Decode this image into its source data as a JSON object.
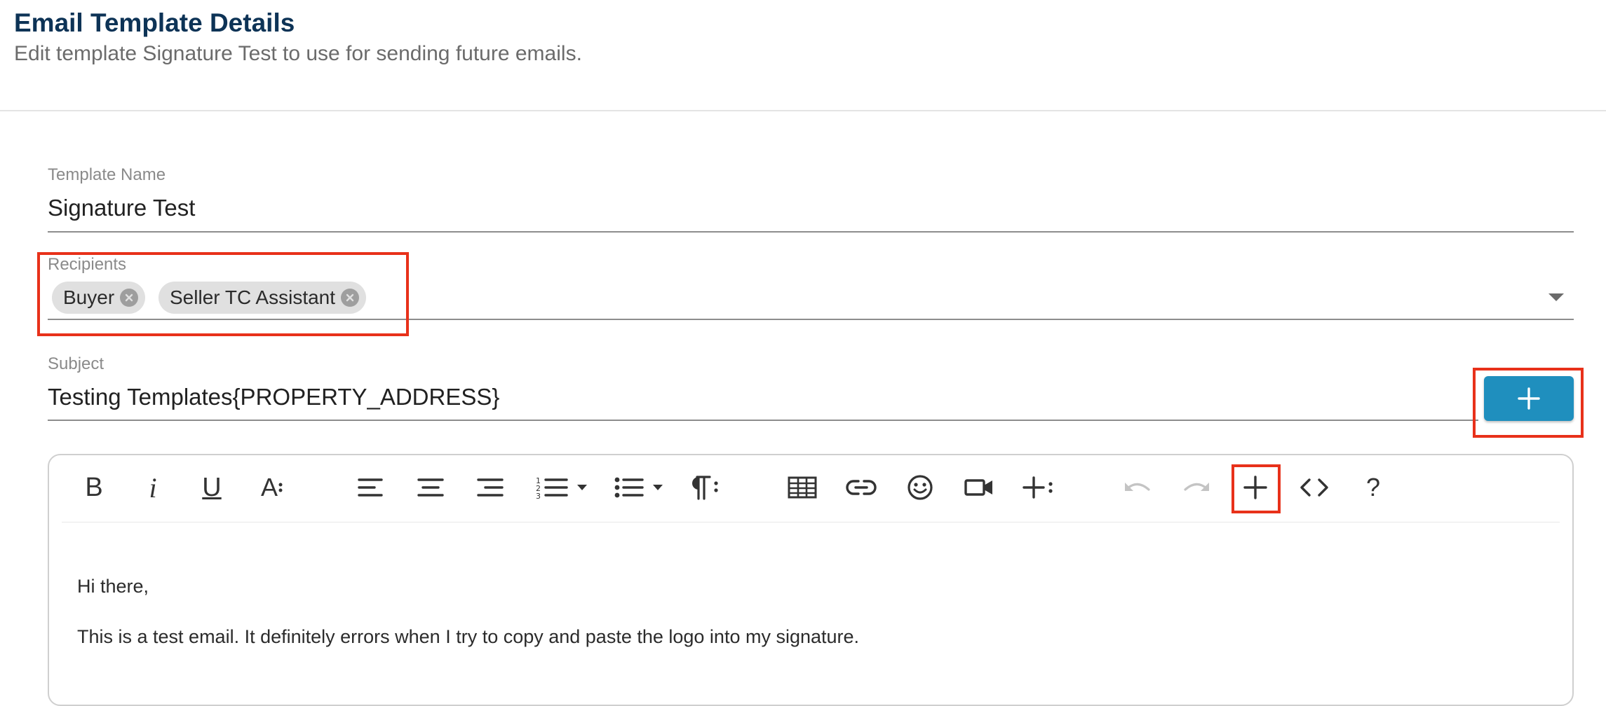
{
  "header": {
    "title": "Email Template Details",
    "subtitle": "Edit template Signature Test to use for sending future emails."
  },
  "form": {
    "template_name": {
      "label": "Template Name",
      "value": "Signature Test"
    },
    "recipients": {
      "label": "Recipients",
      "chips": [
        "Buyer",
        "Seller TC Assistant"
      ]
    },
    "subject": {
      "label": "Subject",
      "value": "Testing Templates{PROPERTY_ADDRESS}"
    }
  },
  "editor": {
    "toolbar": {
      "bold": "B",
      "italic": "i",
      "underline": "U",
      "font_size": "A",
      "help": "?"
    },
    "icons": [
      "bold-icon",
      "italic-icon",
      "underline-icon",
      "font-size-icon",
      "align-left-icon",
      "align-center-icon",
      "align-right-icon",
      "ordered-list-icon",
      "unordered-list-icon",
      "paragraph-format-icon",
      "table-icon",
      "link-icon",
      "emoji-icon",
      "video-icon",
      "insert-more-icon",
      "undo-icon",
      "redo-icon",
      "insert-field-icon",
      "code-view-icon",
      "help-icon"
    ],
    "content": {
      "line1": "Hi there,",
      "line2": "This is a test email. It definitely errors when I try to copy and paste the logo into my signature."
    }
  },
  "colors": {
    "title": "#0d3356",
    "accent": "#1f8fbe",
    "highlight": "#e8311a",
    "chip": "#e0e0e0"
  }
}
